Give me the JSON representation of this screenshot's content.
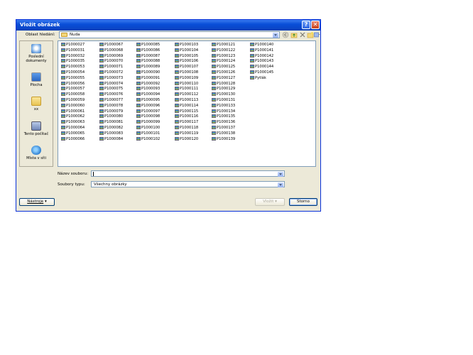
{
  "window": {
    "title": "Vložit obrázek"
  },
  "toolbar": {
    "look_in_label": "Oblast hledání:",
    "look_in_value": "Nuda",
    "icons": [
      "back-icon",
      "up-folder-icon",
      "delete-icon",
      "new-folder-icon",
      "views-icon"
    ]
  },
  "places": [
    {
      "label": "Poslední dokumenty",
      "icon": "recent-documents-icon"
    },
    {
      "label": "Plocha",
      "icon": "desktop-icon"
    },
    {
      "label": "xx",
      "icon": "folder-icon"
    },
    {
      "label": "Tento počítač",
      "icon": "my-computer-icon"
    },
    {
      "label": "Místa v síti",
      "icon": "network-places-icon"
    }
  ],
  "files": [
    [
      "P1000027",
      "P1000031",
      "P1000032",
      "P1000035",
      "P1000053",
      "P1000054",
      "P1000055",
      "P1000056",
      "P1000057",
      "P1000058",
      "P1000059",
      "P1000060",
      "P1000061",
      "P1000062",
      "P1000063",
      "P1000064",
      "P1000065",
      "P1000066"
    ],
    [
      "P1000067",
      "P1000068",
      "P1000069",
      "P1000070",
      "P1000071",
      "P1000072",
      "P1000073",
      "P1000074",
      "P1000075",
      "P1000076",
      "P1000077",
      "P1000078",
      "P1000079",
      "P1000080",
      "P1000081",
      "P1000082",
      "P1000083",
      "P1000084"
    ],
    [
      "P1000085",
      "P1000086",
      "P1000087",
      "P1000088",
      "P1000089",
      "P1000090",
      "P1000091",
      "P1000092",
      "P1000093",
      "P1000094",
      "P1000095",
      "P1000096",
      "P1000097",
      "P1000098",
      "P1000099",
      "P1000100",
      "P1000101",
      "P1000102"
    ],
    [
      "P1000103",
      "P1000104",
      "P1000105",
      "P1000106",
      "P1000107",
      "P1000108",
      "P1000109",
      "P1000110",
      "P1000111",
      "P1000112",
      "P1000113",
      "P1000114",
      "P1000115",
      "P1000116",
      "P1000117",
      "P1000118",
      "P1000119",
      "P1000120"
    ],
    [
      "P1000121",
      "P1000122",
      "P1000123",
      "P1000124",
      "P1000125",
      "P1000126",
      "P1000127",
      "P1000128",
      "P1000129",
      "P1000130",
      "P1000131",
      "P1000133",
      "P1000134",
      "P1000135",
      "P1000136",
      "P1000137",
      "P1000138",
      "P1000139"
    ],
    [
      "P1000140",
      "P1000141",
      "P1000142",
      "P1000143",
      "P1000144",
      "P1000145",
      "Pytlák"
    ]
  ],
  "filename": {
    "label": "Název souboru:",
    "value": ""
  },
  "filetype": {
    "label": "Soubory typu:",
    "value": "Všechny obrázky"
  },
  "buttons": {
    "tools": "Nástroje",
    "insert": "Vložit",
    "cancel": "Storno"
  },
  "colors": {
    "title_bar": "#0a4fd8",
    "dialog_bg": "#ece9d8"
  }
}
